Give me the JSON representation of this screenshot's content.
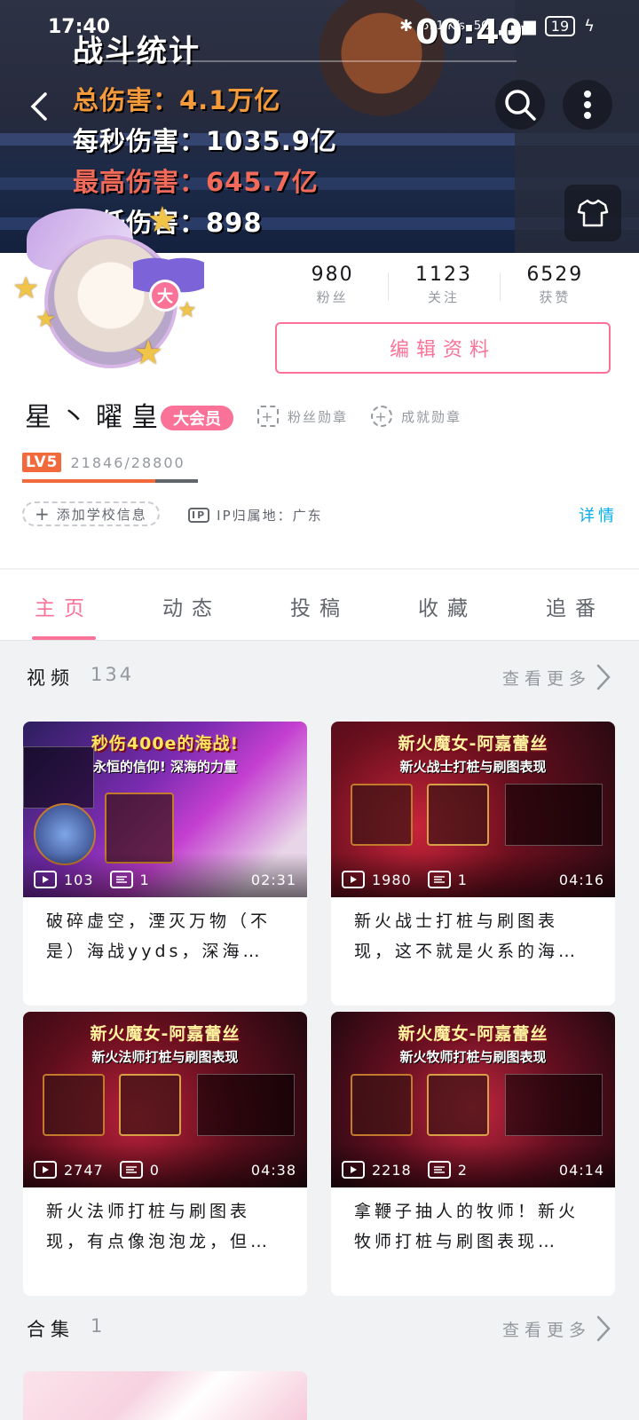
{
  "status_bar": {
    "time": "17:40",
    "network_speed": "591 K/s",
    "signal": "5G",
    "battery": "19",
    "overlay_clock": "00:40"
  },
  "banner": {
    "stats_title": "战斗统计",
    "stats": [
      "总伤害：4.1万亿",
      "每秒伤害：1035.9亿",
      "最高伤害：645.7亿",
      "最低伤害：898"
    ]
  },
  "profile": {
    "avatar_badge": "大",
    "counts": [
      {
        "value": "980",
        "label": "粉丝"
      },
      {
        "value": "1123",
        "label": "关注"
      },
      {
        "value": "6529",
        "label": "获赞"
      }
    ],
    "edit_label": "编辑资料",
    "username": "星丶曜皇",
    "vip_label": "大会员",
    "fan_medal": "粉丝勋章",
    "achievement_medal": "成就勋章",
    "level_badge": "LV5",
    "level_progress": "21846/28800",
    "level_fraction": 0.7585,
    "school_label": "添加学校信息",
    "ip_icon": "IP",
    "ip_label": "IP归属地：广东",
    "details_label": "详情"
  },
  "tabs": [
    "主页",
    "动态",
    "投稿",
    "收藏",
    "追番"
  ],
  "videos_section": {
    "title": "视频",
    "count": "134",
    "more": "查看更多",
    "cards": [
      {
        "thumb_title": "秒伤400e的海战!",
        "thumb_sub": "永恒的信仰! 深海的力量",
        "plays": "103",
        "comments": "1",
        "duration": "02:31",
        "text": "破碎虚空，湮灭万物（不是）海战yyds，深海…"
      },
      {
        "thumb_title": "新火魔女-阿嘉蕾丝",
        "thumb_sub": "新火战士打桩与刷图表现",
        "plays": "1980",
        "comments": "1",
        "duration": "04:16",
        "text": "新火战士打桩与刷图表现，这不就是火系的海…"
      },
      {
        "thumb_title": "新火魔女-阿嘉蕾丝",
        "thumb_sub": "新火法师打桩与刷图表现",
        "plays": "2747",
        "comments": "0",
        "duration": "04:38",
        "text": "新火法师打桩与刷图表现，有点像泡泡龙，但…"
      },
      {
        "thumb_title": "新火魔女-阿嘉蕾丝",
        "thumb_sub": "新火牧师打桩与刷图表现",
        "plays": "2218",
        "comments": "2",
        "duration": "04:14",
        "text": "拿鞭子抽人的牧师！新火牧师打桩与刷图表现…"
      }
    ]
  },
  "collections_section": {
    "title": "合集",
    "count": "1",
    "more": "查看更多"
  },
  "colors": {
    "accent": "#fb7299",
    "link": "#00aeec",
    "level": "#f26a3c"
  }
}
